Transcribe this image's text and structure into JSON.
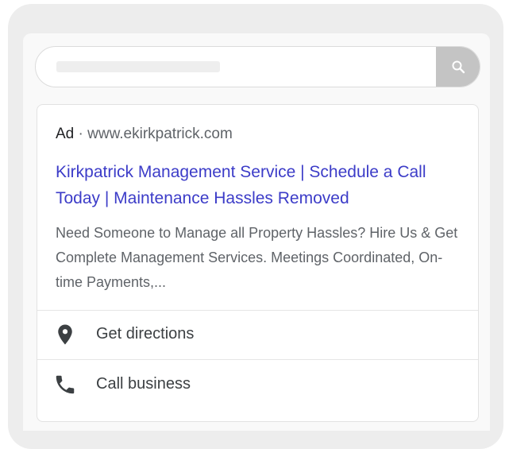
{
  "search": {
    "placeholder": "",
    "button_icon": "search-icon"
  },
  "ad": {
    "label": "Ad",
    "separator": " · ",
    "url": "www.ekirkpatrick.com",
    "title": "Kirkpatrick Management Service | Schedule a Call Today | Maintenance Hassles Removed",
    "description": "Need Someone to Manage all Property Hassles? Hire Us & Get Complete Management Services. Meetings Coordinated, On-time Payments,...",
    "title_color": "#3c3cc8"
  },
  "extensions": [
    {
      "icon": "location-pin-icon",
      "label": "Get directions"
    },
    {
      "icon": "phone-icon",
      "label": "Call business"
    }
  ]
}
